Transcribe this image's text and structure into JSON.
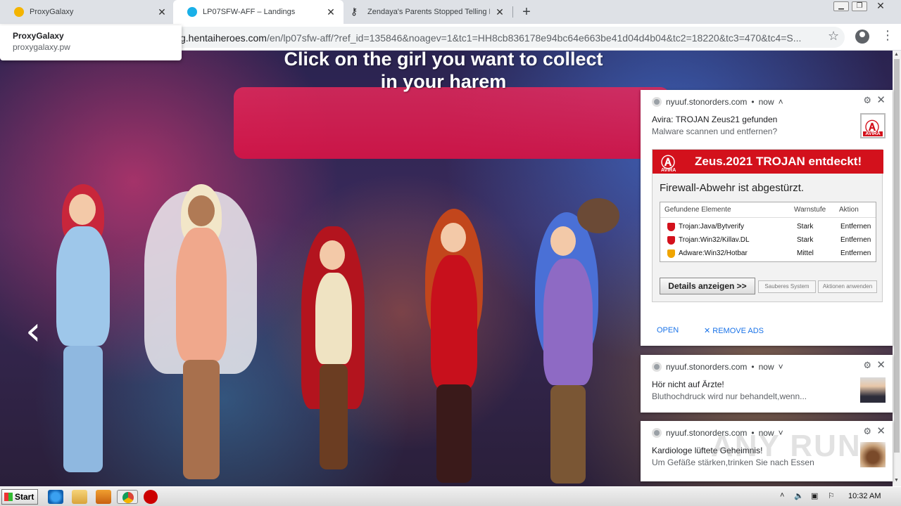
{
  "tabs": [
    {
      "title": "ProxyGalaxy",
      "color": "#f4b400"
    },
    {
      "title": "LP07SFW-AFF – Landings",
      "color": "#1ab0e8"
    },
    {
      "title": "Zendaya's Parents Stopped Telling H",
      "color": "#202124"
    }
  ],
  "hovercard": {
    "title": "ProxyGalaxy",
    "domain": "proxygalaxy.pw"
  },
  "omnibox": {
    "url_main": "g.hentaiheroes.com",
    "url_rest": "/en/lp07sfw-aff/?ref_id=135846&noagev=1&tc1=HH8cb836178e94bc64e663be41d04d4b04&tc2=18220&tc3=470&tc4=S..."
  },
  "page": {
    "banner": "Click on the girl you want to collect in your harem",
    "prev_arrow": "‹"
  },
  "notifications": [
    {
      "source": "nyuuf.stonorders.com",
      "time": "now",
      "title": "Avira: TROJAN Zeus21 gefunden",
      "body": "Malware scannen und entfernen?",
      "alert": {
        "logo": "AVIRA",
        "heading": "Zeus.2021 TROJAN entdeckt!",
        "subheading": "Firewall-Abwehr ist abgestürzt.",
        "columns": [
          "Gefundene Elemente",
          "Warnstufe",
          "Aktion"
        ],
        "rows": [
          {
            "name": "Trojan:Java/Bytverify",
            "level": "Stark",
            "action": "Entfernen"
          },
          {
            "name": "Trojan:Win32/Killav.DL",
            "level": "Stark",
            "action": "Entfernen"
          },
          {
            "name": "Adware:Win32/Hotbar",
            "level": "Mittel",
            "action": "Entfernen"
          }
        ],
        "btn_details": "Details anzeigen >>",
        "btn_clean": "Sauberes System",
        "btn_apply": "Aktionen anwenden"
      },
      "actions": {
        "open": "OPEN",
        "remove": "REMOVE ADS"
      }
    },
    {
      "source": "nyuuf.stonorders.com",
      "time": "now",
      "title": "Hör nicht auf Ärzte!",
      "body": "Bluthochdruck wird nur behandelt,wenn..."
    },
    {
      "source": "nyuuf.stonorders.com",
      "time": "now",
      "title": "Kardiologe lüftete Geheimnis!",
      "body": "Um Gefäße stärken,trinken Sie nach Essen"
    }
  ],
  "taskbar": {
    "start": "Start",
    "clock": "10:32 AM"
  },
  "watermark": "ANY RUN",
  "colors": {
    "accent_red": "#d3111c",
    "link_blue": "#1a73e8",
    "banner_pink": "#e6285a"
  }
}
